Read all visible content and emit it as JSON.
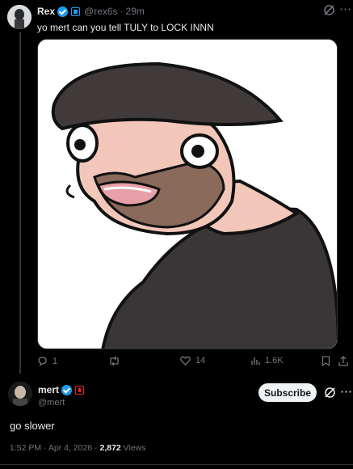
{
  "parent_tweet": {
    "author_name": "Rex",
    "handle": "@rex6s",
    "separator": "·",
    "time_ago": "29m",
    "text": "yo mert can you tell TULY to LOCK INNN",
    "media_alt": "cartoon of a man with a long neck wearing a cap",
    "stats": {
      "replies": "1",
      "retweets": "",
      "likes": "14",
      "views": "1.6K"
    }
  },
  "reply_tweet": {
    "author_name": "mert",
    "handle": "@mert",
    "subscribe_label": "Subscribe",
    "text": "go slower",
    "timestamp": "1:52 PM · Apr 4, 2026 · ",
    "view_count": "2,872",
    "views_label": " Views"
  },
  "colors": {
    "background": "#000000",
    "text": "#e7e9ea",
    "muted": "#71767b",
    "verified": "#1d9bf0"
  },
  "icons": [
    "grok-icon",
    "more-icon",
    "reply-icon",
    "retweet-icon",
    "like-icon",
    "views-icon",
    "bookmark-icon",
    "share-icon"
  ]
}
